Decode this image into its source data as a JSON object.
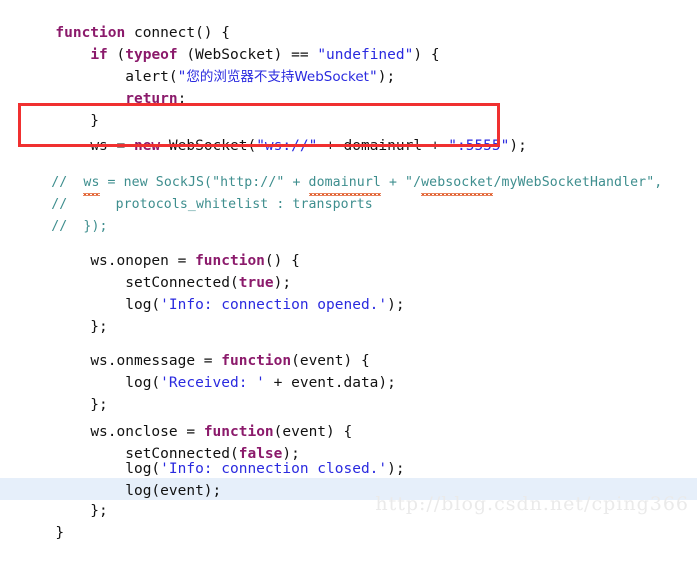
{
  "editor": {
    "language": "javascript",
    "background_color": "#ffffff",
    "default_text_color": "#111111",
    "keyword_color": "#8B1A6B",
    "string_color": "#2A2ADF",
    "comment_color": "#3E8E8E",
    "spellcheck_underline_color": "#E05A27",
    "current_line_highlight_color": "#E6EFFA",
    "annotation_box_color": "#F03030"
  },
  "lines": [
    {
      "id": 1,
      "text": "function connect() {"
    },
    {
      "id": 2,
      "text": "    if (typeof (WebSocket) == \"undefined\") {"
    },
    {
      "id": 3,
      "text": "        alert(\"您的浏览器不支持WebSocket\");"
    },
    {
      "id": 4,
      "text": "        return;"
    },
    {
      "id": 5,
      "text": "    }"
    },
    {
      "id": 6,
      "text": ""
    },
    {
      "id": 7,
      "text": "    ws = new WebSocket(\"ws://\" + domainurl + \":5555\");"
    },
    {
      "id": 8,
      "text": "//  ws = new SockJS(\"http://\" + domainurl + \"/websocket/myWebSocketHandler\","
    },
    {
      "id": 9,
      "text": "//      protocols_whitelist : transports"
    },
    {
      "id": 10,
      "text": "//  });"
    },
    {
      "id": 11,
      "text": ""
    },
    {
      "id": 12,
      "text": "    ws.onopen = function() {"
    },
    {
      "id": 13,
      "text": "        setConnected(true);"
    },
    {
      "id": 14,
      "text": "        log('Info: connection opened.');"
    },
    {
      "id": 15,
      "text": "    };"
    },
    {
      "id": 16,
      "text": ""
    },
    {
      "id": 17,
      "text": "    ws.onmessage = function(event) {"
    },
    {
      "id": 18,
      "text": "        log('Received: ' + event.data);"
    },
    {
      "id": 19,
      "text": "    };"
    },
    {
      "id": 20,
      "text": ""
    },
    {
      "id": 21,
      "text": "    ws.onclose = function(event) {"
    },
    {
      "id": 22,
      "text": "        setConnected(false);"
    },
    {
      "id": 23,
      "text": "        log('Info: connection closed.');"
    },
    {
      "id": 24,
      "text": "        log(event);"
    },
    {
      "id": 25,
      "text": "    };"
    },
    {
      "id": 26,
      "text": "}"
    }
  ],
  "tokens": {
    "l1_kw_function": "function",
    "l1_rest": " connect() {",
    "l2_indent": "    ",
    "l2_kw_if": "if",
    "l2_a": " (",
    "l2_kw_typeof": "typeof",
    "l2_b": " (WebSocket) == ",
    "l2_str": "\"undefined\"",
    "l2_c": ") {",
    "l3_indent": "        ",
    "l3_a": "alert(",
    "l3_q1": "\"",
    "l3_cn": "您的浏览器不支持WebSocket",
    "l3_q2": "\"",
    "l3_b": ");",
    "l4_indent": "        ",
    "l4_kw_return": "return",
    "l4_semi": ";",
    "l5_text": "    }",
    "l7_indent": "    ",
    "l7_a": "ws = ",
    "l7_kw_new": "new",
    "l7_b": " WebSocket(",
    "l7_str1": "\"ws://\"",
    "l7_c": " + domainurl + ",
    "l7_str2": "\":5555\"",
    "l7_d": ");",
    "l8_a": "//  ",
    "l8_ws": "ws",
    "l8_b": " = new SockJS(\"http://\" + ",
    "l8_domainurl": "domainurl",
    "l8_c": " + \"/",
    "l8_websocket": "websocket",
    "l8_d": "/myWebSocketHandler\",",
    "l9_text": "//      protocols_whitelist : transports",
    "l10_text": "//  });",
    "l12_indent": "    ",
    "l12_a": "ws.onopen = ",
    "l12_kw_function": "function",
    "l12_b": "() {",
    "l13_indent": "        ",
    "l13_a": "setConnected(",
    "l13_kw_true": "true",
    "l13_b": ");",
    "l14_indent": "        ",
    "l14_a": "log(",
    "l14_str": "'Info: connection opened.'",
    "l14_b": ");",
    "l15_text": "    };",
    "l17_indent": "    ",
    "l17_a": "ws.onmessage = ",
    "l17_kw_function": "function",
    "l17_b": "(event) {",
    "l18_indent": "        ",
    "l18_a": "log(",
    "l18_str": "'Received: '",
    "l18_b": " + event.data);",
    "l19_text": "    };",
    "l21_indent": "    ",
    "l21_a": "ws.onclose = ",
    "l21_kw_function": "function",
    "l21_b": "(event) {",
    "l22_indent": "        ",
    "l22_a": "setConnected(",
    "l22_kw_false": "false",
    "l22_b": ");",
    "l23_indent": "        ",
    "l23_a": "log(",
    "l23_str": "'Info: connection closed.'",
    "l23_b": ");",
    "l24_indent": "        ",
    "l24_text": "log(event);",
    "l25_text": "    };",
    "l26_text": "}"
  },
  "annotation": {
    "type": "red-rectangle-highlight",
    "target_line": 7,
    "target_text": "ws = new WebSocket(\"ws://\" + domainurl + \":5555\");"
  },
  "watermark": {
    "text": "http://blog.csdn.net/cping366"
  }
}
